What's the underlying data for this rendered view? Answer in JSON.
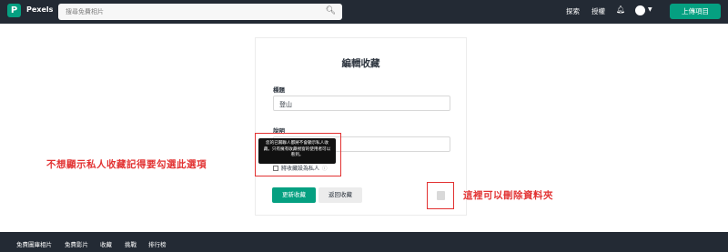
{
  "header": {
    "brand": "Pexels",
    "logo_letter": "P",
    "search_placeholder": "搜尋免費相片",
    "nav": [
      "探索",
      "授權"
    ],
    "upload_label": "上傳項目",
    "icons": {
      "search": "search-icon",
      "bell": "bell-icon",
      "avatar": "avatar",
      "chevron": "chevron-down-icon"
    }
  },
  "card": {
    "title": "編輯收藏",
    "title_field_label": "標題",
    "title_value": "登山",
    "description_label": "說明",
    "tooltip": "您的已關聯人都將不會顯示私人收藏。只有擁有收藏視窗的使用者可以看到。",
    "private_label": "將收藏設為私人",
    "save_label": "更新收藏",
    "back_label": "返回收藏"
  },
  "annotations": {
    "left": "不想顯示私人收藏記得要勾選此選項",
    "right": "這裡可以刪除資料夾"
  },
  "footer": {
    "items": [
      "免費圖庫相片",
      "免費影片",
      "收藏",
      "挑戰",
      "排行榜"
    ]
  },
  "colors": {
    "accent": "#05a081",
    "dark": "#232a34",
    "annotation": "#e23232"
  }
}
